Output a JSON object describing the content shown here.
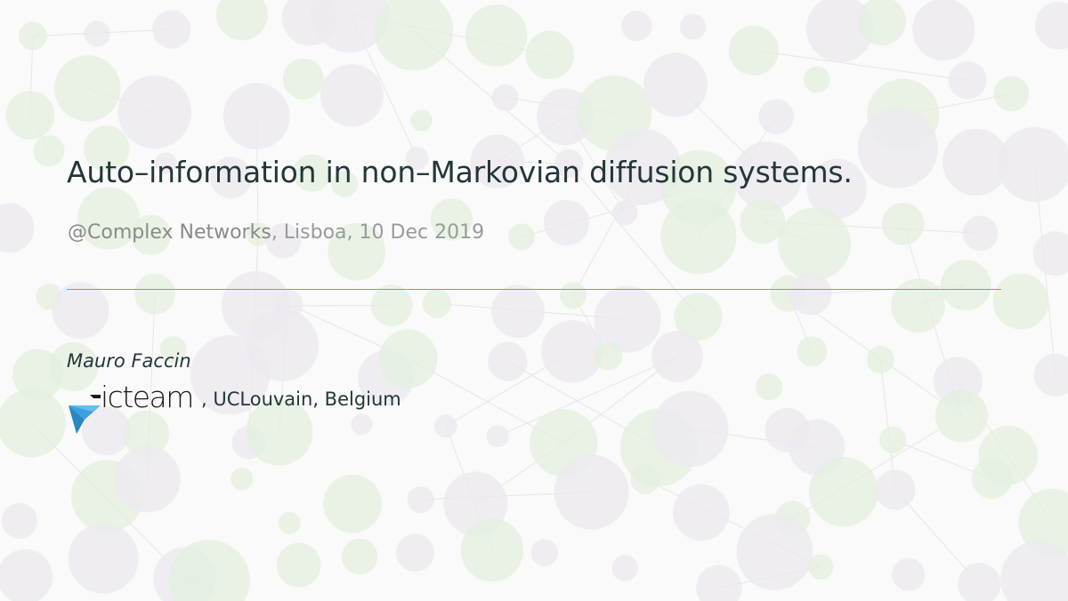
{
  "slide": {
    "title": "Auto–information in non–Markovian diffusion systems.",
    "subtitle_venue": "@Complex Networks",
    "subtitle_rest": ", Lisboa, 10 Dec 2019",
    "author": "Mauro Faccin",
    "affiliation_logo_text": "icteam",
    "affiliation_rest": ", UCLouvain, Belgium"
  },
  "colors": {
    "title": "#23373b",
    "subtitle": "#9a9a9a",
    "rule": "#eb811b",
    "logo_blue": "#3aa0e0",
    "bg_circle_green": "#e3efdd",
    "bg_circle_violet": "#ece8ef"
  },
  "icons": {
    "logo": "icteam-logo-icon"
  }
}
